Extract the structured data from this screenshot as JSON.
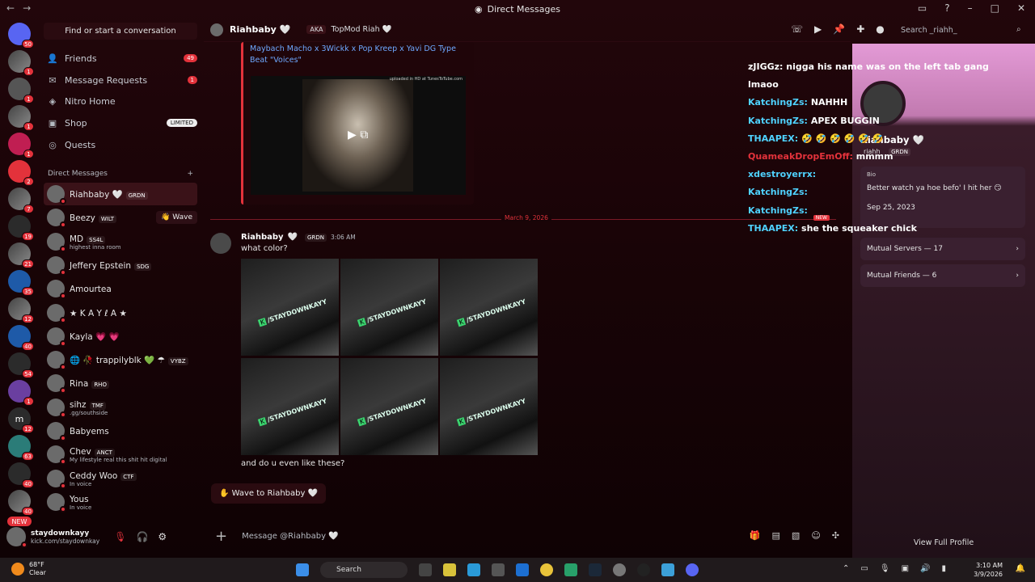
{
  "window": {
    "title": "Direct Messages",
    "nav_back": "←",
    "nav_fwd": "→"
  },
  "guilds": {
    "items": [
      {
        "badge": "50",
        "cls": ""
      },
      {
        "badge": "1",
        "cls": "photo"
      },
      {
        "badge": "1",
        "cls": "gray"
      },
      {
        "badge": "1",
        "cls": "photo"
      },
      {
        "badge": "1",
        "cls": "pink"
      },
      {
        "badge": "2",
        "cls": "red"
      },
      {
        "badge": "7",
        "cls": "photo"
      },
      {
        "badge": "19",
        "cls": "dark"
      },
      {
        "badge": "21",
        "cls": "photo"
      },
      {
        "badge": "35",
        "cls": "blue"
      },
      {
        "badge": "12",
        "cls": "photo"
      },
      {
        "badge": "40",
        "cls": "blue"
      },
      {
        "badge": "54",
        "cls": "dark"
      },
      {
        "badge": "1",
        "cls": "purple"
      },
      {
        "badge": "12",
        "cls": "dark"
      },
      {
        "badge": "63",
        "cls": "teal"
      },
      {
        "badge": "40",
        "cls": "dark"
      },
      {
        "badge": "40",
        "cls": "photo"
      }
    ],
    "new_label": "NEW",
    "dm_letter": "m"
  },
  "sidebar": {
    "find_placeholder": "Find or start a conversation",
    "friends": "Friends",
    "friends_badge": "49",
    "message_requests": "Message Requests",
    "requests_badge": "1",
    "nitro": "Nitro Home",
    "shop": "Shop",
    "shop_badge": "LIMITED",
    "quests": "Quests",
    "dm_header": "Direct Messages",
    "dm_add": "+",
    "dms": [
      {
        "name": "Riahbaby 🤍",
        "tag": "GRDN",
        "sub": ""
      },
      {
        "name": "Beezy",
        "tag": "WILT",
        "sub": ""
      },
      {
        "name": "MD",
        "tag": "SS4L",
        "sub": "highest inna room"
      },
      {
        "name": "Jeffery Epstein",
        "tag": "SDG",
        "sub": ""
      },
      {
        "name": "Amourtea",
        "tag": "",
        "sub": ""
      },
      {
        "name": "★ K A Y ℓ A ★",
        "tag": "",
        "sub": ""
      },
      {
        "name": "Kayla 💗 💗",
        "tag": "",
        "sub": ""
      },
      {
        "name": "🌐 🥀 trappilyblk 💚 ☂",
        "tag": "VYBZ",
        "sub": ""
      },
      {
        "name": "Rina",
        "tag": "RHO",
        "sub": ""
      },
      {
        "name": "sihz",
        "tag": "TMF",
        "sub": ".gg/southside"
      },
      {
        "name": "Babyems",
        "tag": "",
        "sub": ""
      },
      {
        "name": "Chev",
        "tag": "ANCT",
        "sub": "My lifestyle real this shit hit digital"
      },
      {
        "name": "Ceddy Woo",
        "tag": "CTF",
        "sub": "In voice"
      },
      {
        "name": "Yous",
        "tag": "",
        "sub": "In voice"
      }
    ],
    "wave_label": "👋 Wave",
    "user_name": "staydownkayy",
    "user_status": "kick.com/staydownkay"
  },
  "header": {
    "name": "Riahbaby 🤍",
    "aka": "AKA",
    "aka_name": "TopMod Riah 🤍",
    "search_placeholder": "Search _riahh_"
  },
  "messages": {
    "embed_title": "Maybach Macho x 3Wickk x Pop Kreep x Yavi DG Type Beat \"Voices\"",
    "embed_caption": "uploaded in HD at TunesToTube.com",
    "date_divider": "March 9, 2026",
    "new_badge": "NEW",
    "author": "Riahbaby",
    "author_tag": "GRDN",
    "time": "3:06 AM",
    "text1": "what color?",
    "text2": "and do u even like these?",
    "wave_button": "Wave to Riahbaby 🤍",
    "photo_label": "/STAYDOWNKAYY",
    "compose_placeholder": "Message @Riahbaby 🤍"
  },
  "overlay": {
    "lines": [
      {
        "user": "zJIGGz:",
        "text": "nigga his name was on the left tab gang lmaoo",
        "cls": "y"
      },
      {
        "user": "KatchingZs:",
        "text": "NAHHH",
        "cls": "u"
      },
      {
        "user": "KatchingZs:",
        "text": "APEX BUGGIN",
        "cls": "u"
      },
      {
        "user": "THAAPEX:",
        "text": "🤣 🤣 🤣 🤣 🤣 🤣",
        "cls": "u"
      },
      {
        "user": "QuameakDropEmOff:",
        "text": "mmmm",
        "cls": "r"
      },
      {
        "user": "xdestroyerrx:",
        "text": "",
        "cls": "u"
      },
      {
        "user": "KatchingZs:",
        "text": "",
        "cls": "u"
      },
      {
        "user": "KatchingZs:",
        "text": "",
        "cls": "u"
      },
      {
        "user": "THAAPEX:",
        "text": "she the squeaker chick",
        "cls": "u"
      }
    ]
  },
  "profile": {
    "name": "Riahbaby 🤍",
    "username": "_riahh_",
    "tag": "GRDN",
    "bio_title": "Bio",
    "bio": "Better watch ya hoe befo' I hit her 😏",
    "since": "Sep 25, 2023",
    "mutual_servers": "Mutual Servers — 17",
    "mutual_friends": "Mutual Friends — 6",
    "view_full": "View Full Profile"
  },
  "taskbar": {
    "temp": "68°F",
    "cond": "Clear",
    "search": "Search",
    "time": "3:10 AM",
    "date": "3/9/2026"
  }
}
